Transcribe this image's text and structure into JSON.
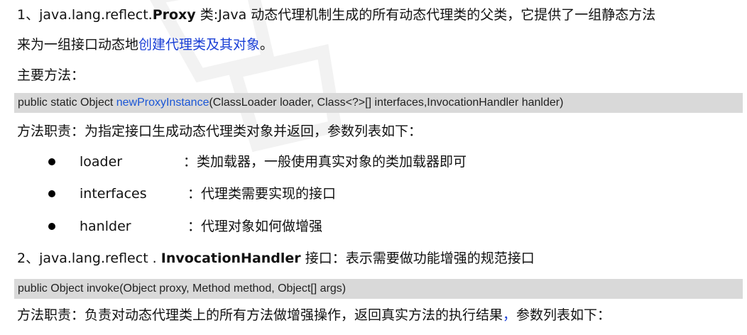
{
  "paragraph1": {
    "prefix": "1、java.lang.reflect.",
    "class_name": "Proxy",
    "text_a": " 类:Java 动态代理机制生成的所有动态代理类的父类，它提供了一组静态方法",
    "text_b": "来为一组接口动态地",
    "link_text": "创建代理类及其对象",
    "text_c": "。"
  },
  "main_methods_label": "主要方法：",
  "code1": {
    "before": "public static Object ",
    "method": "newProxyInstance",
    "after": "(ClassLoader loader, Class<?>[] interfaces,InvocationHandler hanlder)"
  },
  "method_desc1": "方法职责：为指定接口生成动态代理类对象并返回，参数列表如下：",
  "params": [
    {
      "name": "loader",
      "desc": "：类加载器，一般使用真实对象的类加载器即可"
    },
    {
      "name": "interfaces",
      "desc": "：代理类需要实现的接口"
    },
    {
      "name": "hanlder",
      "desc": "：代理对象如何做增强"
    }
  ],
  "paragraph2": {
    "prefix": "2、java.lang.reflect . ",
    "class_name": "InvocationHandler",
    "text": " 接口：表示需要做功能增强的规范接口"
  },
  "code2": "public Object invoke(Object proxy, Method method, Object[] args)",
  "method_desc2": {
    "text_a": "方法职责：负责对动态代理类上的所有方法做增强操作，返回真实方法的执行结果",
    "comma": "，",
    "text_b": "参数列表如下："
  },
  "colors": {
    "link_blue": "#1a3fd6",
    "code_background": "#d9d9d9"
  }
}
